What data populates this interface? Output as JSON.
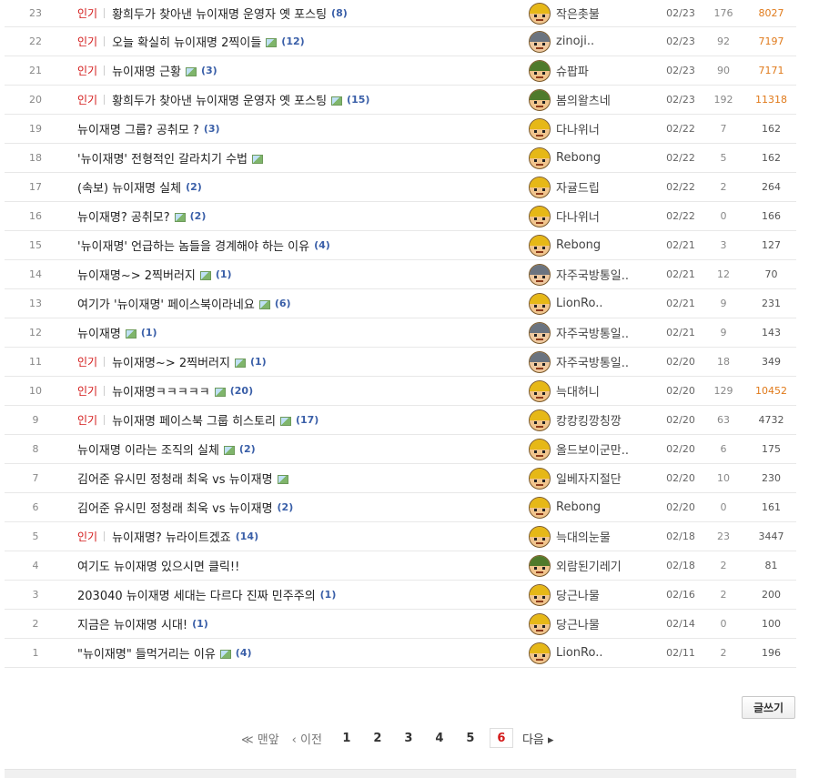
{
  "hot_label": "인기",
  "rows": [
    {
      "num": "23",
      "hot": true,
      "title": "황희두가 찾아낸 뉴이재명 운영자 옛 포스팅",
      "img": false,
      "count": "(8)",
      "writer": "작은촛불",
      "date": "02/23",
      "rec": "176",
      "views": "8027",
      "views_hot": true,
      "avatar": "yellow"
    },
    {
      "num": "22",
      "hot": true,
      "title": "오늘 확실히 뉴이재명 2찍이들",
      "img": true,
      "count": "(12)",
      "writer": "zinoji..",
      "date": "02/23",
      "rec": "92",
      "views": "7197",
      "views_hot": true,
      "avatar": "gray"
    },
    {
      "num": "21",
      "hot": true,
      "title": "뉴이재명 근황",
      "img": true,
      "count": "(3)",
      "writer": "슈팝파",
      "date": "02/23",
      "rec": "90",
      "views": "7171",
      "views_hot": true,
      "avatar": "green"
    },
    {
      "num": "20",
      "hot": true,
      "title": "황희두가 찾아낸 뉴이재명 운영자 옛 포스팅",
      "img": true,
      "count": "(15)",
      "writer": "봄의왈츠네",
      "date": "02/23",
      "rec": "192",
      "views": "11318",
      "views_hot": true,
      "avatar": "green"
    },
    {
      "num": "19",
      "hot": false,
      "title": "뉴이재명 그룹? 공취모 ?",
      "img": false,
      "count": "(3)",
      "writer": "다나위너",
      "date": "02/22",
      "rec": "7",
      "views": "162",
      "views_hot": false,
      "avatar": "yellow"
    },
    {
      "num": "18",
      "hot": false,
      "title": "'뉴이재명' 전형적인 갈라치기 수법",
      "img": true,
      "count": "",
      "writer": "Rebong",
      "date": "02/22",
      "rec": "5",
      "views": "162",
      "views_hot": false,
      "avatar": "yellow"
    },
    {
      "num": "17",
      "hot": false,
      "title": "(속보) 뉴이재명 실체",
      "img": false,
      "count": "(2)",
      "writer": "자귤드립",
      "date": "02/22",
      "rec": "2",
      "views": "264",
      "views_hot": false,
      "avatar": "yellow"
    },
    {
      "num": "16",
      "hot": false,
      "title": "뉴이재명? 공취모?",
      "img": true,
      "count": "(2)",
      "writer": "다나위너",
      "date": "02/22",
      "rec": "0",
      "views": "166",
      "views_hot": false,
      "avatar": "yellow"
    },
    {
      "num": "15",
      "hot": false,
      "title": "'뉴이재명' 언급하는 놈들을 경계해야 하는 이유",
      "img": false,
      "count": "(4)",
      "writer": "Rebong",
      "date": "02/21",
      "rec": "3",
      "views": "127",
      "views_hot": false,
      "avatar": "yellow"
    },
    {
      "num": "14",
      "hot": false,
      "title": "뉴이재명~> 2찍버러지",
      "img": true,
      "count": "(1)",
      "writer": "자주국방통일..",
      "date": "02/21",
      "rec": "12",
      "views": "70",
      "views_hot": false,
      "avatar": "gray"
    },
    {
      "num": "13",
      "hot": false,
      "title": "여기가 '뉴이재명' 페이스북이라네요",
      "img": true,
      "count": "(6)",
      "writer": "LionRo..",
      "date": "02/21",
      "rec": "9",
      "views": "231",
      "views_hot": false,
      "avatar": "yellow"
    },
    {
      "num": "12",
      "hot": false,
      "title": "뉴이재명",
      "img": true,
      "count": "(1)",
      "writer": "자주국방통일..",
      "date": "02/21",
      "rec": "9",
      "views": "143",
      "views_hot": false,
      "avatar": "gray"
    },
    {
      "num": "11",
      "hot": true,
      "title": "뉴이재명~> 2찍버러지",
      "img": true,
      "count": "(1)",
      "writer": "자주국방통일..",
      "date": "02/20",
      "rec": "18",
      "views": "349",
      "views_hot": false,
      "avatar": "gray"
    },
    {
      "num": "10",
      "hot": true,
      "title": "뉴이재명ㅋㅋㅋㅋㅋ",
      "img": true,
      "count": "(20)",
      "writer": "늑대허니",
      "date": "02/20",
      "rec": "129",
      "views": "10452",
      "views_hot": true,
      "avatar": "yellow"
    },
    {
      "num": "9",
      "hot": true,
      "title": "뉴이재명 페이스북 그룹 히스토리",
      "img": true,
      "count": "(17)",
      "writer": "캉캉킹깡칭깡",
      "date": "02/20",
      "rec": "63",
      "views": "4732",
      "views_hot": false,
      "avatar": "yellow"
    },
    {
      "num": "8",
      "hot": false,
      "title": "뉴이재명 이라는 조직의 실체",
      "img": true,
      "count": "(2)",
      "writer": "올드보이군만..",
      "date": "02/20",
      "rec": "6",
      "views": "175",
      "views_hot": false,
      "avatar": "yellow"
    },
    {
      "num": "7",
      "hot": false,
      "title": "김어준 유시민 정청래 최욱 vs 뉴이재명",
      "img": true,
      "count": "",
      "writer": "일베자지절단",
      "date": "02/20",
      "rec": "10",
      "views": "230",
      "views_hot": false,
      "avatar": "yellow"
    },
    {
      "num": "6",
      "hot": false,
      "title": "김어준 유시민 정청래 최욱 vs 뉴이재명",
      "img": false,
      "count": "(2)",
      "writer": "Rebong",
      "date": "02/20",
      "rec": "0",
      "views": "161",
      "views_hot": false,
      "avatar": "yellow"
    },
    {
      "num": "5",
      "hot": true,
      "title": "뉴이재명? 뉴라이트겠죠",
      "img": false,
      "count": "(14)",
      "writer": "늑대의눈물",
      "date": "02/18",
      "rec": "23",
      "views": "3447",
      "views_hot": false,
      "avatar": "yellow"
    },
    {
      "num": "4",
      "hot": false,
      "title": "여기도 뉴이재명 있으시면 클릭!!",
      "img": false,
      "count": "",
      "writer": "외람된기레기",
      "date": "02/18",
      "rec": "2",
      "views": "81",
      "views_hot": false,
      "avatar": "green"
    },
    {
      "num": "3",
      "hot": false,
      "title": "203040 뉴이재명 세대는 다르다 진짜 민주주의",
      "img": false,
      "count": "(1)",
      "writer": "당근나물",
      "date": "02/16",
      "rec": "2",
      "views": "200",
      "views_hot": false,
      "avatar": "yellow"
    },
    {
      "num": "2",
      "hot": false,
      "title": "지금은 뉴이재명 시대!",
      "img": false,
      "count": "(1)",
      "writer": "당근나물",
      "date": "02/14",
      "rec": "0",
      "views": "100",
      "views_hot": false,
      "avatar": "yellow"
    },
    {
      "num": "1",
      "hot": false,
      "title": "\"뉴이재명\" 들먹거리는 이유",
      "img": true,
      "count": "(4)",
      "writer": "LionRo..",
      "date": "02/11",
      "rec": "2",
      "views": "196",
      "views_hot": false,
      "avatar": "yellow"
    }
  ],
  "write_button": "글쓰기",
  "pager": {
    "first": "≪ 맨앞",
    "prev": "‹ 이전",
    "pages": [
      "1",
      "2",
      "3",
      "4",
      "5",
      "6"
    ],
    "current": "6",
    "next": "다음 ▸"
  },
  "colors": {
    "hot": "#d31919",
    "count": "#3a5fa8",
    "views_hot": "#e07a1b"
  }
}
